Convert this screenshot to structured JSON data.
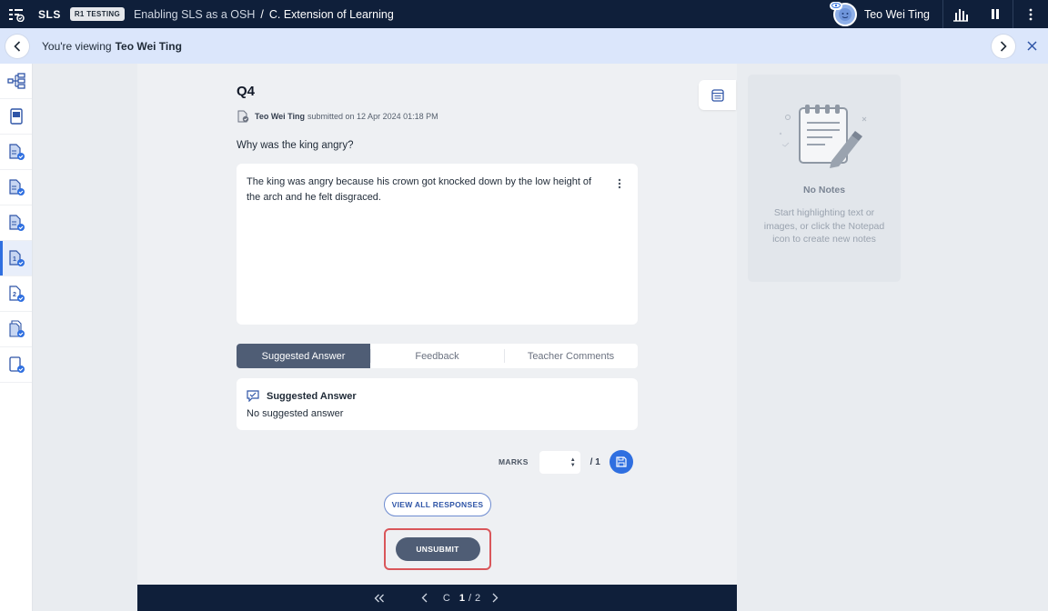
{
  "topbar": {
    "brand": "SLS",
    "badge": "R1 TESTING",
    "breadcrumb_lesson": "Enabling SLS as a OSH",
    "breadcrumb_separator": "/",
    "breadcrumb_section": "C. Extension of Learning",
    "user_name": "Teo Wei Ting"
  },
  "viewbar": {
    "prefix": "You're viewing",
    "student_name": "Teo Wei Ting"
  },
  "question": {
    "title": "Q4",
    "submitter": "Teo Wei Ting",
    "submitted_text": "submitted on 12 Apr 2024 01:18 PM",
    "prompt": "Why was the king angry?",
    "answer": "The king was angry because his crown got knocked down by the low height of the arch and he felt disgraced."
  },
  "tabs": [
    {
      "label": "Suggested Answer",
      "active": true
    },
    {
      "label": "Feedback",
      "active": false
    },
    {
      "label": "Teacher Comments",
      "active": false
    }
  ],
  "suggested": {
    "heading": "Suggested Answer",
    "text": "No suggested answer"
  },
  "marks": {
    "label": "MARKS",
    "value": "",
    "total": "/ 1"
  },
  "buttons": {
    "view_all": "VIEW ALL RESPONSES",
    "unsubmit": "UNSUBMIT"
  },
  "pager": {
    "section": "C",
    "current": "1",
    "separator": "/",
    "total": "2"
  },
  "notes": {
    "title": "No Notes",
    "description": "Start highlighting text or images, or click the Notepad icon to create new notes"
  },
  "colors": {
    "topbar": "#0f1f3a",
    "viewbar": "#dbe6fb",
    "accent": "#2f6fe0",
    "active_tab": "#4f5d75",
    "highlight": "#d9565a"
  }
}
